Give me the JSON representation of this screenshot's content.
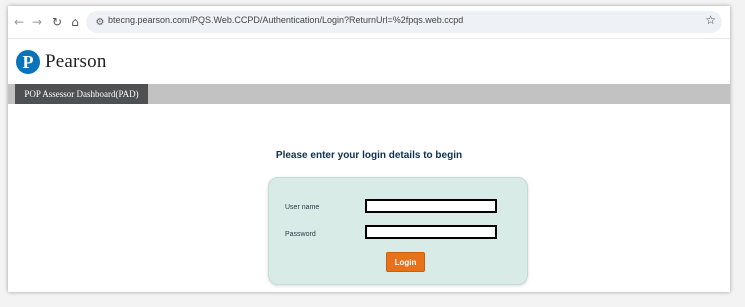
{
  "browser": {
    "url": "btecng.pearson.com/PQS.Web.CCPD/Authentication/Login?ReturnUrl=%2fpqs.web.ccpd",
    "icons": [
      "back-arrow-icon",
      "forward-arrow-icon",
      "reload-icon",
      "home-icon",
      "site-info-icon",
      "bookmark-star-icon"
    ]
  },
  "header": {
    "logo_mark": "P",
    "logo_text": "Pearson"
  },
  "nav": {
    "tab_label": "POP Assessor Dashboard(PAD)"
  },
  "main": {
    "heading": "Please enter your login details to begin"
  },
  "login": {
    "username_label": "User name",
    "username_value": "",
    "password_label": "Password",
    "password_value": "",
    "button_label": "Login"
  },
  "colors": {
    "logo_blue": "#0b73b9",
    "nav_strip": "#c2c2c2",
    "nav_tab": "#4f5052",
    "heading": "#102f51",
    "panel_bg": "#d8ebe6",
    "login_button": "#e8711a"
  }
}
